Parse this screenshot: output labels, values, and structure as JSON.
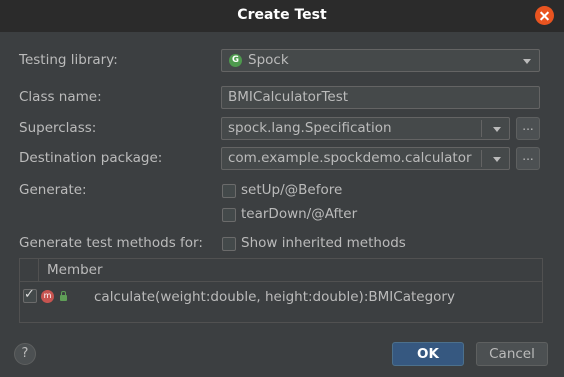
{
  "dialog": {
    "title": "Create Test",
    "close_icon": "close-icon"
  },
  "form": {
    "testing_library_label": "Testing library:",
    "testing_library_value": "Spock",
    "testing_library_icon_letter": "G",
    "class_name_label": "Class name:",
    "class_name_value": "BMICalculatorTest",
    "superclass_label": "Superclass:",
    "superclass_value": "spock.lang.Specification",
    "destination_label": "Destination package:",
    "destination_value": "com.example.spockdemo.calculator",
    "browse_label": "...",
    "generate_label": "Generate:",
    "setup_label": "setUp/@Before",
    "setup_checked": false,
    "teardown_label": "tearDown/@After",
    "teardown_checked": false,
    "methods_for_label": "Generate test methods for:",
    "show_inherited_label": "Show inherited methods",
    "show_inherited_checked": false
  },
  "members_table": {
    "header": "Member",
    "rows": [
      {
        "checked": true,
        "icon_letter": "m",
        "signature": "calculate(weight:double, height:double):BMICategory"
      }
    ]
  },
  "footer": {
    "help_label": "?",
    "ok_label": "OK",
    "cancel_label": "Cancel"
  },
  "colors": {
    "background": "#3c3f41",
    "titlebar": "#2b2b2b",
    "close_button": "#e95420",
    "ok_button": "#365880",
    "method_icon": "#c75450",
    "library_icon": "#4e9a4e"
  }
}
